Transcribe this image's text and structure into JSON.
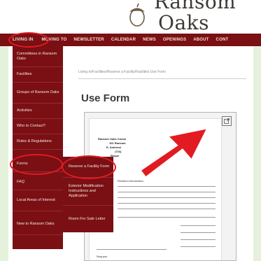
{
  "site": {
    "logo_line1": "Ransom",
    "logo_line2": "Oaks"
  },
  "nav": {
    "items": [
      "LIVING IN",
      "MOVING TO",
      "NEWSLETTER",
      "CALENDAR",
      "NEWS",
      "OPENINGS",
      "ABOUT",
      "CONT"
    ]
  },
  "breadcrumb": "Living In/Facilities/Reserve a Facility/Facilities Use Form",
  "page_title": "Use Form",
  "living_in_menu": [
    "Committees in Ransom Oaks",
    "Facilities",
    "Groups of Ransom Oaks",
    "Activities",
    "Who to Contact?",
    "Rules & Regulations",
    "Forms",
    "FAQ",
    "Local Areas of Interest",
    "New to Ransom Oaks"
  ],
  "forms_submenu": [
    "Reserve a Facility Form",
    "Exterior Modification Instructions and Application",
    "Room For Sale Letter"
  ],
  "document": {
    "heading_lines": [
      "Ransom Oaks Comm",
      "101 Ransom",
      "E. Amherst",
      "(716)",
      "Reque"
    ],
    "side_labels": [
      "Resident Information",
      "Request"
    ]
  },
  "annotation": {
    "ring_color": "#e21b22",
    "arrow_color": "#e21b22"
  }
}
